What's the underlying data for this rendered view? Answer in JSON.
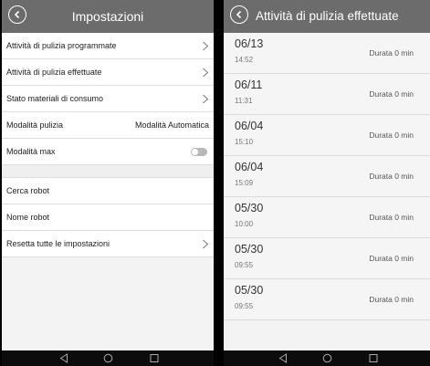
{
  "left": {
    "header": {
      "title": "Impostazioni"
    },
    "items": [
      {
        "label": "Attività di pulizia programmate",
        "chevron": true
      },
      {
        "label": "Attività di pulizia effettuate",
        "chevron": true
      },
      {
        "label": "Stato materiali di consumo",
        "chevron": true
      },
      {
        "label": "Modalità pulizia",
        "value": "Modalità Automatica"
      },
      {
        "label": "Modalità max",
        "toggle": "off"
      }
    ],
    "items2": [
      {
        "label": "Cerca robot"
      },
      {
        "label": "Nome robot"
      },
      {
        "label": "Resetta tutte le impostazioni",
        "chevron": true
      }
    ]
  },
  "right": {
    "header": {
      "title": "Attività di pulizia effettuate"
    },
    "records": [
      {
        "date": "06/13",
        "time": "14:52",
        "duration": "Durata 0 min"
      },
      {
        "date": "06/11",
        "time": "11:31",
        "duration": "Durata 0 min"
      },
      {
        "date": "06/04",
        "time": "15:10",
        "duration": "Durata 0 min"
      },
      {
        "date": "06/04",
        "time": "15:09",
        "duration": "Durata 0 min"
      },
      {
        "date": "05/30",
        "time": "10:00",
        "duration": "Durata 0 min"
      },
      {
        "date": "05/30",
        "time": "09:55",
        "duration": "Durata 0 min"
      },
      {
        "date": "05/30",
        "time": "09:55",
        "duration": "Durata 0 min"
      }
    ]
  },
  "icons": {
    "back": "back-arrow-icon",
    "chevron": "chevron-right-icon",
    "nav": [
      "nav-back-icon",
      "nav-home-icon",
      "nav-recent-icon"
    ]
  }
}
